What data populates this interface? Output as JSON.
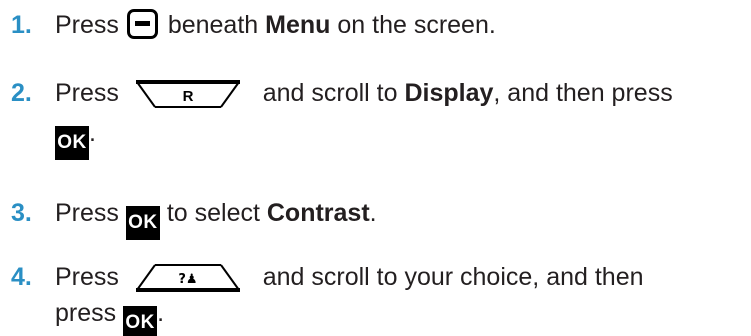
{
  "steps": [
    {
      "number": "1.",
      "parts": {
        "a": "Press",
        "b": "beneath",
        "c": "Menu",
        "d": "on the screen."
      }
    },
    {
      "number": "2.",
      "parts": {
        "a": "Press",
        "key_letter": "R",
        "b": "and scroll to",
        "c": "Display",
        "d": ", and then press",
        "ok": "OK",
        "e": "."
      }
    },
    {
      "number": "3.",
      "parts": {
        "a": "Press",
        "ok": "OK",
        "b": "to select",
        "c": "Contrast",
        "d": "."
      }
    },
    {
      "number": "4.",
      "parts": {
        "a": "Press",
        "key_symbol": "?♟",
        "b": "and scroll to your choice, and then",
        "c": "press",
        "ok": "OK",
        "d": "."
      }
    }
  ],
  "icons": {
    "softkey": "softkey-icon",
    "ok": "ok-key-icon",
    "right_key": "right-key-icon",
    "contacts_key": "contacts-key-icon"
  },
  "colors": {
    "step_number": "#2a8fc4",
    "text": "#231f20",
    "key": "#000000"
  }
}
